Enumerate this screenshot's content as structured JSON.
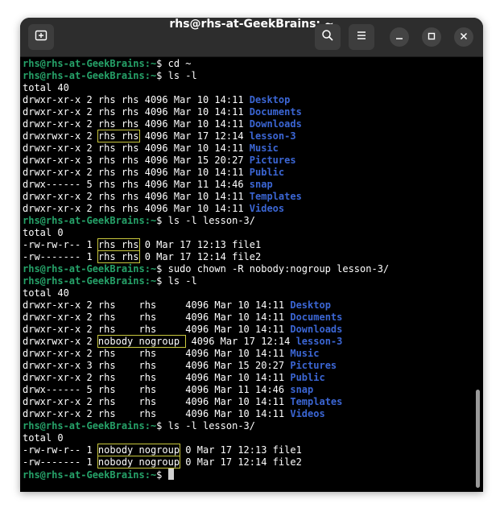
{
  "window": {
    "title": "rhs@rhs-at-GeekBrains: ~"
  },
  "icons": {
    "new_tab": "new-tab-icon",
    "search": "search-icon",
    "menu": "hamburger-menu-icon",
    "minimize": "minimize-icon",
    "maximize": "maximize-icon",
    "close": "close-icon"
  },
  "colors": {
    "prompt": "#26a269",
    "directory": "#3b66d4",
    "highlight": "#c9c83d",
    "background": "#000000",
    "titlebar": "#2d2d2d"
  },
  "terminal": {
    "prompt_user": "rhs@rhs-at-GeekBrains",
    "lines": [
      {
        "type": "prompt",
        "path": ":~",
        "cmd": "$ cd ~"
      },
      {
        "type": "prompt",
        "path": ":~",
        "cmd": "$ ls -l"
      },
      {
        "type": "text",
        "text": "total 40"
      },
      {
        "type": "entry",
        "perm": "drwxr-xr-x 2 ",
        "owner": "rhs rhs",
        "rest": " 4096 Mar 10 14:11 ",
        "name": "Desktop",
        "dir": true,
        "hl": false
      },
      {
        "type": "entry",
        "perm": "drwxr-xr-x 2 ",
        "owner": "rhs rhs",
        "rest": " 4096 Mar 10 14:11 ",
        "name": "Documents",
        "dir": true,
        "hl": false
      },
      {
        "type": "entry",
        "perm": "drwxr-xr-x 2 ",
        "owner": "rhs rhs",
        "rest": " 4096 Mar 10 14:11 ",
        "name": "Downloads",
        "dir": true,
        "hl": false
      },
      {
        "type": "entry",
        "perm": "drwxrwxr-x 2 ",
        "owner": "rhs rhs",
        "rest": " 4096 Mar 17 12:14 ",
        "name": "lesson-3",
        "dir": true,
        "hl": true
      },
      {
        "type": "entry",
        "perm": "drwxr-xr-x 2 ",
        "owner": "rhs rhs",
        "rest": " 4096 Mar 10 14:11 ",
        "name": "Music",
        "dir": true,
        "hl": false
      },
      {
        "type": "entry",
        "perm": "drwxr-xr-x 3 ",
        "owner": "rhs rhs",
        "rest": " 4096 Mar 15 20:27 ",
        "name": "Pictures",
        "dir": true,
        "hl": false
      },
      {
        "type": "entry",
        "perm": "drwxr-xr-x 2 ",
        "owner": "rhs rhs",
        "rest": " 4096 Mar 10 14:11 ",
        "name": "Public",
        "dir": true,
        "hl": false
      },
      {
        "type": "entry",
        "perm": "drwx------ 5 ",
        "owner": "rhs rhs",
        "rest": " 4096 Mar 11 14:46 ",
        "name": "snap",
        "dir": true,
        "hl": false
      },
      {
        "type": "entry",
        "perm": "drwxr-xr-x 2 ",
        "owner": "rhs rhs",
        "rest": " 4096 Mar 10 14:11 ",
        "name": "Templates",
        "dir": true,
        "hl": false
      },
      {
        "type": "entry",
        "perm": "drwxr-xr-x 2 ",
        "owner": "rhs rhs",
        "rest": " 4096 Mar 10 14:11 ",
        "name": "Videos",
        "dir": true,
        "hl": false
      },
      {
        "type": "prompt",
        "path": ":~",
        "cmd": "$ ls -l lesson-3/"
      },
      {
        "type": "text",
        "text": "total 0"
      },
      {
        "type": "entry",
        "perm": "-rw-rw-r-- 1 ",
        "owner": "rhs rhs",
        "rest": " 0 Mar 17 12:13 ",
        "name": "file1",
        "dir": false,
        "hl": true
      },
      {
        "type": "entry",
        "perm": "-rw------- 1 ",
        "owner": "rhs rhs",
        "rest": " 0 Mar 17 12:14 ",
        "name": "file2",
        "dir": false,
        "hl": true
      },
      {
        "type": "prompt",
        "path": ":~",
        "cmd": "$ sudo chown -R nobody:nogroup lesson-3/"
      },
      {
        "type": "prompt",
        "path": ":~",
        "cmd": "$ ls -l"
      },
      {
        "type": "text",
        "text": "total 40"
      },
      {
        "type": "entry",
        "perm": "drwxr-xr-x 2 ",
        "owner": "rhs    rhs    ",
        "rest": " 4096 Mar 10 14:11 ",
        "name": "Desktop",
        "dir": true,
        "hl": false
      },
      {
        "type": "entry",
        "perm": "drwxr-xr-x 2 ",
        "owner": "rhs    rhs    ",
        "rest": " 4096 Mar 10 14:11 ",
        "name": "Documents",
        "dir": true,
        "hl": false
      },
      {
        "type": "entry",
        "perm": "drwxr-xr-x 2 ",
        "owner": "rhs    rhs    ",
        "rest": " 4096 Mar 10 14:11 ",
        "name": "Downloads",
        "dir": true,
        "hl": false
      },
      {
        "type": "entry",
        "perm": "drwxrwxr-x 2 ",
        "owner": "nobody nogroup ",
        "rest": " 4096 Mar 17 12:14 ",
        "name": "lesson-3",
        "dir": true,
        "hl": true
      },
      {
        "type": "entry",
        "perm": "drwxr-xr-x 2 ",
        "owner": "rhs    rhs    ",
        "rest": " 4096 Mar 10 14:11 ",
        "name": "Music",
        "dir": true,
        "hl": false
      },
      {
        "type": "entry",
        "perm": "drwxr-xr-x 3 ",
        "owner": "rhs    rhs    ",
        "rest": " 4096 Mar 15 20:27 ",
        "name": "Pictures",
        "dir": true,
        "hl": false
      },
      {
        "type": "entry",
        "perm": "drwxr-xr-x 2 ",
        "owner": "rhs    rhs    ",
        "rest": " 4096 Mar 10 14:11 ",
        "name": "Public",
        "dir": true,
        "hl": false
      },
      {
        "type": "entry",
        "perm": "drwx------ 5 ",
        "owner": "rhs    rhs    ",
        "rest": " 4096 Mar 11 14:46 ",
        "name": "snap",
        "dir": true,
        "hl": false
      },
      {
        "type": "entry",
        "perm": "drwxr-xr-x 2 ",
        "owner": "rhs    rhs    ",
        "rest": " 4096 Mar 10 14:11 ",
        "name": "Templates",
        "dir": true,
        "hl": false
      },
      {
        "type": "entry",
        "perm": "drwxr-xr-x 2 ",
        "owner": "rhs    rhs    ",
        "rest": " 4096 Mar 10 14:11 ",
        "name": "Videos",
        "dir": true,
        "hl": false
      },
      {
        "type": "prompt",
        "path": ":~",
        "cmd": "$ ls -l lesson-3/"
      },
      {
        "type": "text",
        "text": "total 0"
      },
      {
        "type": "entry",
        "perm": "-rw-rw-r-- 1 ",
        "owner": "nobody nogroup",
        "rest": " 0 Mar 17 12:13 ",
        "name": "file1",
        "dir": false,
        "hl": true
      },
      {
        "type": "entry",
        "perm": "-rw------- 1 ",
        "owner": "nobody nogroup",
        "rest": " 0 Mar 17 12:14 ",
        "name": "file2",
        "dir": false,
        "hl": true
      },
      {
        "type": "prompt",
        "path": ":~",
        "cmd": "$ ",
        "cursor": true
      }
    ]
  }
}
